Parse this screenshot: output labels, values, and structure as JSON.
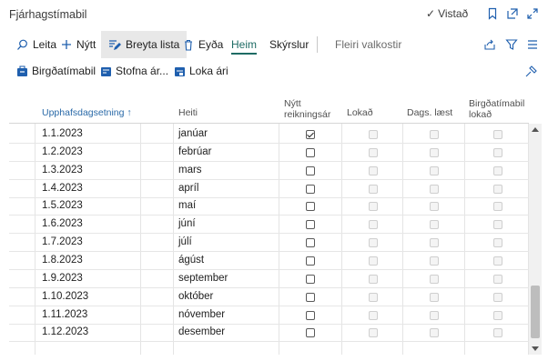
{
  "window": {
    "title": "Fjárhagstímabil",
    "saved_label": "Vistað"
  },
  "actions": {
    "search": "Leita",
    "new": "Nýtt",
    "edit_list": "Breyta lista",
    "delete": "Eyða",
    "home": "Heim",
    "reports": "Skýrslur",
    "more": "Fleiri valkostir"
  },
  "subactions": {
    "inventory_period": "Birgðatímabil",
    "create_year": "Stofna ár...",
    "close_year": "Loka ári"
  },
  "columns": {
    "start_date": "Upphafsdagsetning ↑",
    "name": "Heiti",
    "new_fiscal_year_1": "Nýtt",
    "new_fiscal_year_2": "reikningsár",
    "closed": "Lokað",
    "date_locked": "Dags. læst",
    "inventory_closed_1": "Birgðatímabil",
    "inventory_closed_2": "lokað"
  },
  "rows": [
    {
      "date": "1.1.2023",
      "name": "janúar",
      "new_year": true
    },
    {
      "date": "1.2.2023",
      "name": "febrúar",
      "new_year": false
    },
    {
      "date": "1.3.2023",
      "name": "mars",
      "new_year": false
    },
    {
      "date": "1.4.2023",
      "name": "apríl",
      "new_year": false
    },
    {
      "date": "1.5.2023",
      "name": "maí",
      "new_year": false
    },
    {
      "date": "1.6.2023",
      "name": "júní",
      "new_year": false
    },
    {
      "date": "1.7.2023",
      "name": "júlí",
      "new_year": false
    },
    {
      "date": "1.8.2023",
      "name": "ágúst",
      "new_year": false
    },
    {
      "date": "1.9.2023",
      "name": "september",
      "new_year": false
    },
    {
      "date": "1.10.2023",
      "name": "október",
      "new_year": false
    },
    {
      "date": "1.11.2023",
      "name": "nóvember",
      "new_year": false
    },
    {
      "date": "1.12.2023",
      "name": "desember",
      "new_year": false
    }
  ],
  "colors": {
    "accent": "#1e6b64",
    "active_bg": "#e8e8e8",
    "icon_blue": "#1f5fae"
  }
}
